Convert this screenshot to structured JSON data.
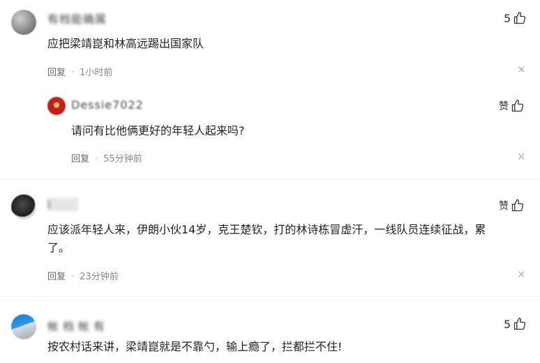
{
  "comments": [
    {
      "user": "有档能确属",
      "text": "应把梁靖崑和林高远踢出国家队",
      "reply_label": "回复",
      "time": "1小时前",
      "like": "5",
      "close": "✕",
      "reply": {
        "user": "Dessie7022",
        "text": "请问有比他俩更好的年轻人起来吗?",
        "reply_label": "回复",
        "time": "55分钟前",
        "like": "赞",
        "close": "✕"
      }
    },
    {
      "user": "i",
      "text_line1": "应该派年轻人来，伊朗小伙14岁，克王楚钦，打的林诗栋冒虚汗，一线队员连续征战，累",
      "text_line2": "了。",
      "reply_label": "回复",
      "time": "23分钟前",
      "like": "赞",
      "close": "✕"
    },
    {
      "user": "帐档帐有",
      "text": "按农村话来讲，梁靖崑就是不靠勺，输上瘾了，拦都拦不住!",
      "like": "5"
    }
  ],
  "icons": {
    "like": "thumbs-up-icon",
    "close": "close-icon"
  }
}
